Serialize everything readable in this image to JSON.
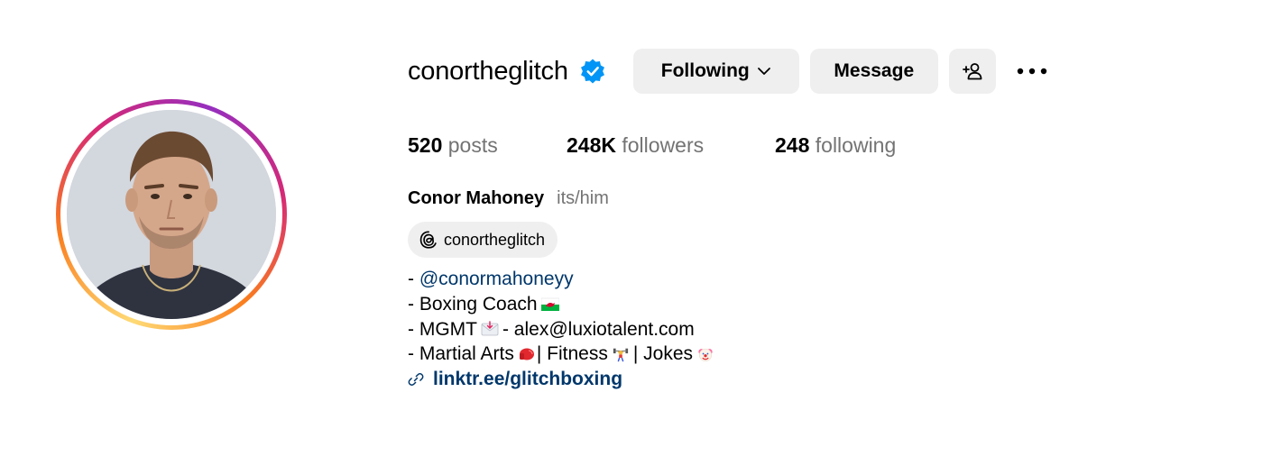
{
  "profile": {
    "username": "conortheglitch",
    "verified_icon": "verified-badge-icon",
    "full_name": "Conor Mahoney",
    "pronouns": "its/him"
  },
  "actions": {
    "following_label": "Following",
    "message_label": "Message",
    "add_user_icon": "person-add-icon",
    "more_icon": "more-options-icon"
  },
  "stats": {
    "posts_count": "520",
    "posts_label": "posts",
    "followers_count": "248K",
    "followers_label": "followers",
    "following_count": "248",
    "following_label": "following"
  },
  "threads": {
    "handle": "conortheglitch",
    "icon": "threads-icon"
  },
  "bio": {
    "line1_prefix": "- ",
    "line1_mention": "@conormahoneyy",
    "line2": "- Boxing Coach",
    "line2_emoji": "wales-flag-icon",
    "line3_prefix": "- MGMT",
    "line3_emoji": "envelope-icon",
    "line3_suffix": "- alex@luxiotalent.com",
    "line4_a": "- Martial Arts",
    "line4_emoji1": "boxing-glove-icon",
    "line4_b": "| Fitness",
    "line4_emoji2": "weightlifter-icon",
    "line4_c": "| Jokes",
    "line4_emoji3": "clown-face-icon",
    "link": "linktr.ee/glitchboxing",
    "link_icon": "link-icon"
  },
  "colors": {
    "verified_blue": "#0095f6",
    "link_blue": "#00376b",
    "button_bg": "#efefef",
    "muted_text": "#737373"
  }
}
